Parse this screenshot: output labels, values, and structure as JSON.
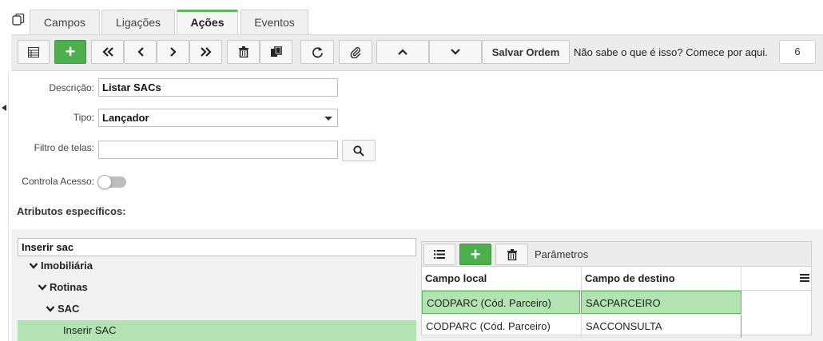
{
  "tabs": [
    {
      "label": "Campos",
      "active": false
    },
    {
      "label": "Ligações",
      "active": false
    },
    {
      "label": "Ações",
      "active": true
    },
    {
      "label": "Eventos",
      "active": false
    }
  ],
  "toolbar": {
    "save_order_label": "Salvar Ordem",
    "help_text": "Não sabe o que é isso? Comece por aqui.",
    "count": "6"
  },
  "form": {
    "descricao_label": "Descrição:",
    "descricao_value": "Listar SACs",
    "tipo_label": "Tipo:",
    "tipo_value": "Lançador",
    "filtro_label": "Filtro de telas:",
    "filtro_value": "",
    "controla_label": "Controla Acesso:",
    "controla_on": false
  },
  "section": {
    "atributos_title": "Atributos específicos:"
  },
  "tree": {
    "search_value": "Inserir sac",
    "items": [
      {
        "label": "Imobiliária",
        "level": 0
      },
      {
        "label": "Rotinas",
        "level": 1
      },
      {
        "label": "SAC",
        "level": 2
      }
    ],
    "selected": "Inserir SAC"
  },
  "params": {
    "title": "Parâmetros",
    "columns": [
      "Campo local",
      "Campo de destino"
    ],
    "rows": [
      {
        "local": "CODPARC (Cód. Parceiro)",
        "destino": "SACPARCEIRO",
        "selected": true
      },
      {
        "local": "CODPARC (Cód. Parceiro)",
        "destino": "SACCONSULTA",
        "selected": false
      }
    ]
  },
  "colors": {
    "accent_green": "#4cae4c",
    "selection_green": "#b3e2b3"
  }
}
